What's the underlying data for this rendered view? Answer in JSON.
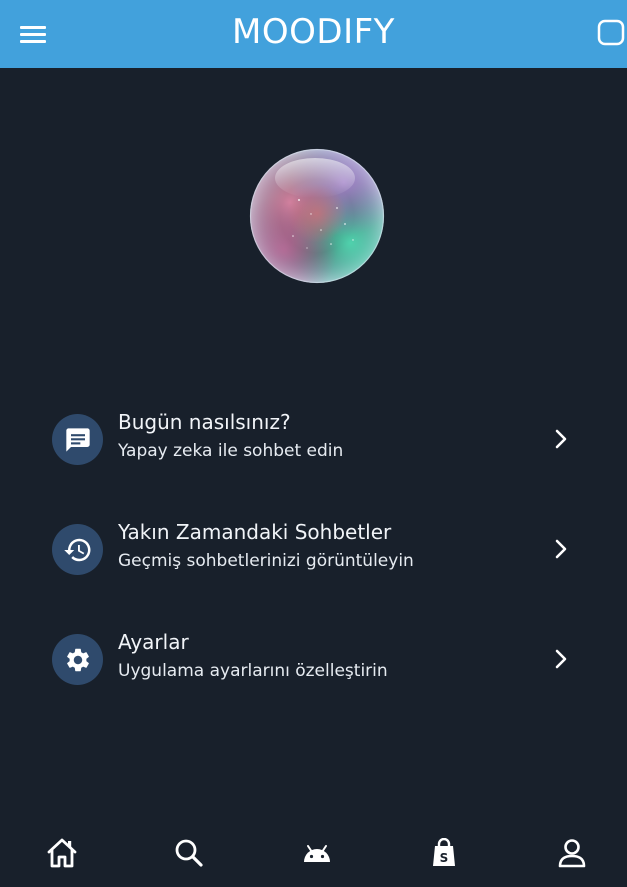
{
  "app": {
    "title": "MOODIFY"
  },
  "colors": {
    "appbar": "#42a1dc",
    "background": "#18202b",
    "icon_circle": "#2f4a6c",
    "text": "#ffffff"
  },
  "appbar": {
    "left_icon": "hamburger-menu-icon",
    "right_icon": "rounded-square-icon"
  },
  "hero": {
    "image": "iridescent-bubble-orb"
  },
  "menu": [
    {
      "icon": "chat-icon",
      "title": "Bugün nasılsınız?",
      "subtitle": "Yapay zeka ile sohbet edin"
    },
    {
      "icon": "history-icon",
      "title": "Yakın Zamandaki Sohbetler",
      "subtitle": "Geçmiş sohbetlerinizi görüntüleyin"
    },
    {
      "icon": "gear-icon",
      "title": "Ayarlar",
      "subtitle": "Uygulama ayarlarını özelleştirin"
    }
  ],
  "bottom_nav": [
    {
      "icon": "home-icon"
    },
    {
      "icon": "search-icon"
    },
    {
      "icon": "android-icon"
    },
    {
      "icon": "shopping-bag-icon"
    },
    {
      "icon": "person-icon"
    }
  ]
}
